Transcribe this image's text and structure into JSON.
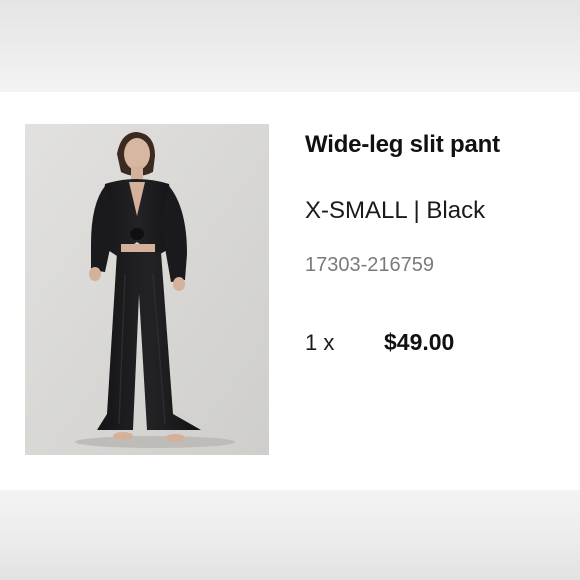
{
  "product": {
    "image_alt": "Model wearing black wide-leg slit pant with matching tie-front top",
    "title": "Wide-leg slit pant",
    "variant": "X-SMALL | Black",
    "sku": "17303-216759",
    "quantity": "1 x",
    "price": "$49.00"
  },
  "colors": {
    "title": "#111111",
    "sku": "#7a7a7a",
    "card_background": "#ffffff",
    "page_background": "#efefef",
    "photo_background": "#d9d8d6",
    "garment": "#1b1b1d"
  }
}
